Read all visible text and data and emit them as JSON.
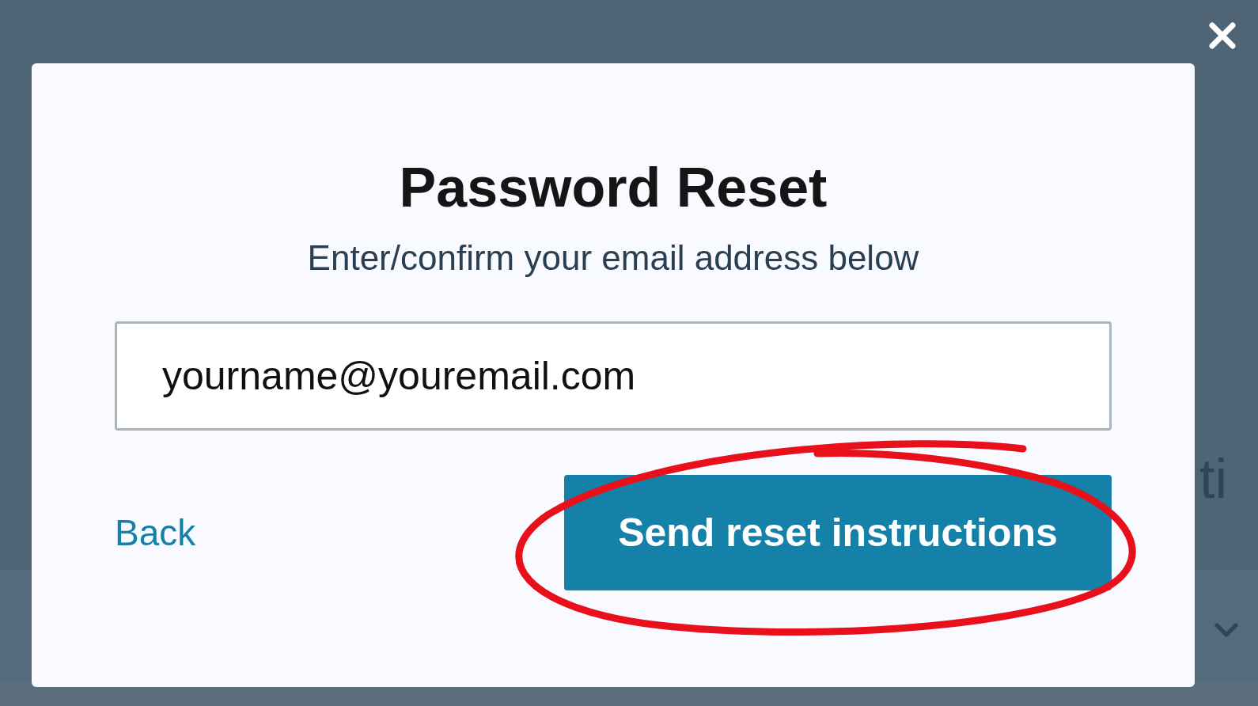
{
  "background": {
    "line_fragment": "ti"
  },
  "dialog": {
    "title": "Password Reset",
    "subtitle": "Enter/confirm your email address below",
    "email_field": {
      "value": "yourname@youremail.com"
    },
    "back_link": "Back",
    "submit_button": "Send reset instructions",
    "annotation": {
      "kind": "circled"
    }
  }
}
